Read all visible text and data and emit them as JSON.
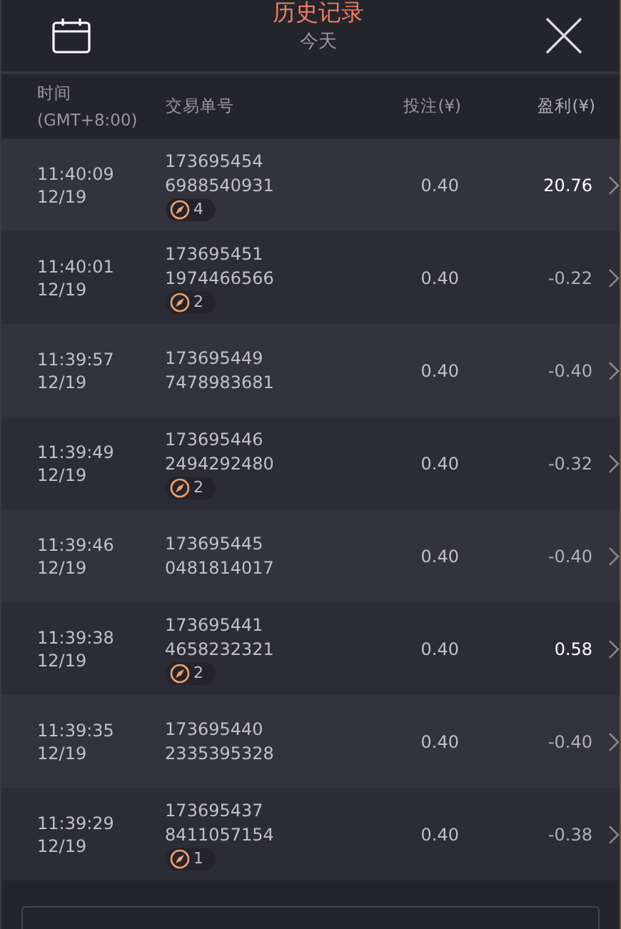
{
  "header": {
    "title": "历史记录",
    "subtitle": "今天"
  },
  "columns": {
    "time": "时间",
    "timezone": "(GMT+8:00)",
    "order": "交易单号",
    "stake": "投注(¥)",
    "profit": "盈利(¥)"
  },
  "rows": [
    {
      "time": "11:40:09",
      "date": "12/19",
      "order_a": "173695454",
      "order_b": "6988540931",
      "count": "4",
      "stake": "0.40",
      "profit": "20.76",
      "win": true
    },
    {
      "time": "11:40:01",
      "date": "12/19",
      "order_a": "173695451",
      "order_b": "1974466566",
      "count": "2",
      "stake": "0.40",
      "profit": "-0.22",
      "win": false
    },
    {
      "time": "11:39:57",
      "date": "12/19",
      "order_a": "173695449",
      "order_b": "7478983681",
      "stake": "0.40",
      "profit": "-0.40",
      "win": false
    },
    {
      "time": "11:39:49",
      "date": "12/19",
      "order_a": "173695446",
      "order_b": "2494292480",
      "count": "2",
      "stake": "0.40",
      "profit": "-0.32",
      "win": false
    },
    {
      "time": "11:39:46",
      "date": "12/19",
      "order_a": "173695445",
      "order_b": "0481814017",
      "stake": "0.40",
      "profit": "-0.40",
      "win": false
    },
    {
      "time": "11:39:38",
      "date": "12/19",
      "order_a": "173695441",
      "order_b": "4658232321",
      "count": "2",
      "stake": "0.40",
      "profit": "0.58",
      "win": true
    },
    {
      "time": "11:39:35",
      "date": "12/19",
      "order_a": "173695440",
      "order_b": "2335395328",
      "stake": "0.40",
      "profit": "-0.40",
      "win": false
    },
    {
      "time": "11:39:29",
      "date": "12/19",
      "order_a": "173695437",
      "order_b": "8411057154",
      "count": "1",
      "stake": "0.40",
      "profit": "-0.38",
      "win": false
    }
  ]
}
